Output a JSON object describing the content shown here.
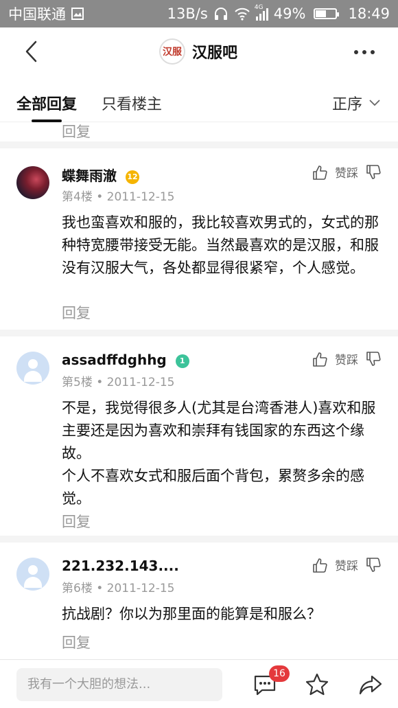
{
  "status_bar": {
    "carrier": "中国联通",
    "speed": "13B/s",
    "network": "4G",
    "battery": "49%",
    "battery_level": 0.49,
    "time": "18:49"
  },
  "header": {
    "forum_logo": "汉服",
    "forum_name": "汉服吧"
  },
  "tabs": {
    "all_replies": "全部回复",
    "op_only": "只看楼主",
    "sort": "正序"
  },
  "reply_label": "回复",
  "like_label": "赞踩",
  "posts": [
    {
      "username": "蝶舞雨澈",
      "badge": "12",
      "badge_color": "#f5b400",
      "floor": "第4楼",
      "date": "2011-12-15",
      "text": "我也蛮喜欢和服的，我比较喜欢男式的，女式的那种特宽腰带接受无能。当然最喜欢的是汉服，和服没有汉服大气，各处都显得很紧窄，个人感觉。"
    },
    {
      "username": "assadffdghhg",
      "badge": "1",
      "badge_color": "#3cc39a",
      "floor": "第5楼",
      "date": "2011-12-15",
      "text_lines": [
        "不是，我觉得很多人(尤其是台湾香港人)喜欢和服主要还是因为喜欢和崇拜有钱国家的东西这个缘故。",
        "个人不喜欢女式和服后面个背包，累赘多余的感觉。"
      ]
    },
    {
      "username": "221.232.143....",
      "floor": "第6楼",
      "date": "2011-12-15",
      "text": "抗战剧？你以为那里面的能算是和服么？"
    }
  ],
  "bottom_bar": {
    "placeholder": "我有一个大胆的想法...",
    "comment_count": "16"
  },
  "icons": {
    "back": "chevron-left-icon",
    "more": "more-dots-icon",
    "sort": "chevron-down-icon",
    "like": "thumbs-up-icon",
    "dislike": "thumbs-down-icon",
    "comment": "comment-bubble-icon",
    "favorite": "star-icon",
    "share": "share-icon"
  }
}
